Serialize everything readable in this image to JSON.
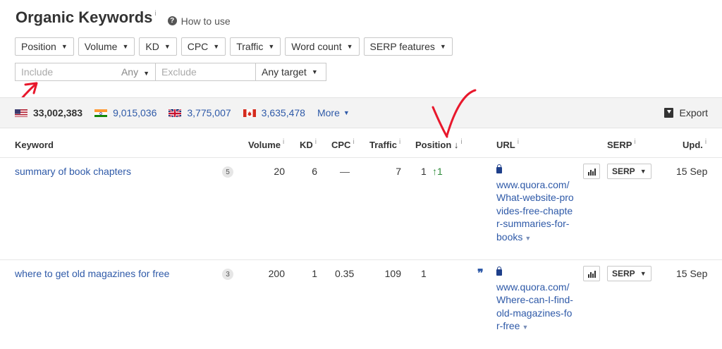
{
  "header": {
    "title": "Organic Keywords",
    "info_mark": "i",
    "how_to_use": "How to use"
  },
  "filters": [
    "Position",
    "Volume",
    "KD",
    "CPC",
    "Traffic",
    "Word count",
    "SERP features"
  ],
  "include": {
    "placeholder": "Include",
    "any_label": "Any",
    "exclude_placeholder": "Exclude",
    "target_label": "Any target"
  },
  "countries": [
    {
      "flag": "us",
      "count": "33,002,383"
    },
    {
      "flag": "in",
      "count": "9,015,036"
    },
    {
      "flag": "gb",
      "count": "3,775,007"
    },
    {
      "flag": "ca",
      "count": "3,635,478"
    }
  ],
  "more_label": "More",
  "export_label": "Export",
  "columns": {
    "keyword": "Keyword",
    "volume": "Volume",
    "kd": "KD",
    "cpc": "CPC",
    "traffic": "Traffic",
    "position": "Position",
    "sort_arrow": "↓",
    "url": "URL",
    "serp": "SERP",
    "upd": "Upd."
  },
  "rows": [
    {
      "keyword": "summary of book chapters",
      "badge": "5",
      "volume": "20",
      "kd": "6",
      "cpc": "—",
      "traffic": "7",
      "position": "1",
      "position_change": "↑1",
      "url": "www.quora.com/What-website-provides-free-chapter-summaries-for-books",
      "serp": "SERP",
      "upd": "15 Sep"
    },
    {
      "keyword": "where to get old magazines for free",
      "badge": "3",
      "volume": "200",
      "kd": "1",
      "cpc": "0.35",
      "traffic": "109",
      "position": "1",
      "position_change": "",
      "url": "www.quora.com/Where-can-I-find-old-magazines-for-free",
      "serp": "SERP",
      "upd": "15 Sep"
    }
  ],
  "colors": {
    "link": "#2f5aa8",
    "positive": "#2e8b3a",
    "annotation": "#e8182c"
  }
}
